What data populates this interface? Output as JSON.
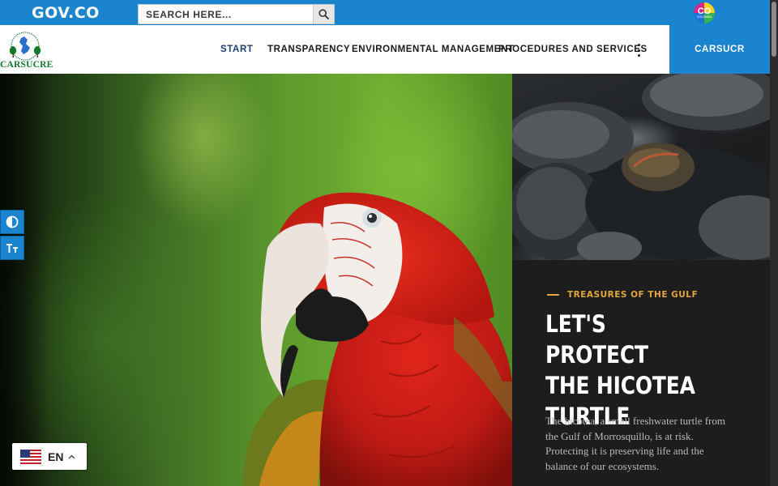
{
  "gov_bar": {
    "logo_text": "GOV.CO",
    "search_placeholder": "SEARCH HERE...",
    "search_button_icon": "search-icon",
    "country_badge": {
      "text": "CO",
      "subtext": "COLOMBIA",
      "icon": "colombia-badge-icon"
    }
  },
  "header": {
    "brand_name": "CARSUCRE",
    "brand_emblem_icon": "carsucre-emblem-icon",
    "nav": [
      {
        "label": "START",
        "active": true
      },
      {
        "label": "TRANSPARENCY",
        "active": false
      },
      {
        "label": "ENVIRONMENTAL MANAGEMENT",
        "active": false
      },
      {
        "label": "PROCEDURES AND SERVICES",
        "active": false
      }
    ],
    "more_icon": "more-vertical-icon",
    "cta_label": "CARSUCR"
  },
  "hero": {
    "image_subject": "scarlet-macaw-photo",
    "side_image_subject": "turtles-photo",
    "eyebrow": "TREASURES OF THE GULF",
    "headline_lines": [
      "LET'S PROTECT",
      "THE HICOTEA",
      "TURTLE"
    ],
    "description_lines": [
      "The hicotea, a small freshwater turtle from",
      "the Gulf of Morrosquillo, is at risk.",
      "Protecting it is preserving life and the",
      "balance of our ecosystems."
    ]
  },
  "accessibility": {
    "contrast_icon": "contrast-icon",
    "text_size_icon": "text-size-icon"
  },
  "language": {
    "code": "EN",
    "flag_icon": "us-flag-icon",
    "caret_icon": "chevron-up-icon"
  },
  "colors": {
    "gov_blue": "#1a84cf",
    "accent_gold": "#e2a73c",
    "panel_dark": "#1d1d1d",
    "brand_green": "#0f7a2e"
  }
}
